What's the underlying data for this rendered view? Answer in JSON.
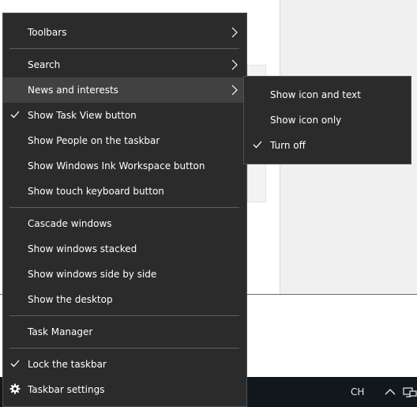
{
  "context_menu": {
    "items": [
      {
        "label": "Toolbars",
        "submenu": true
      },
      {
        "label": "Search",
        "submenu": true
      },
      {
        "label": "News and interests",
        "submenu": true,
        "highlighted": true
      },
      {
        "label": "Show Task View button",
        "checked": true
      },
      {
        "label": "Show People on the taskbar"
      },
      {
        "label": "Show Windows Ink Workspace button"
      },
      {
        "label": "Show touch keyboard button"
      },
      {
        "label": "Cascade windows"
      },
      {
        "label": "Show windows stacked"
      },
      {
        "label": "Show windows side by side"
      },
      {
        "label": "Show the desktop"
      },
      {
        "label": "Task Manager"
      },
      {
        "label": "Lock the taskbar",
        "checked": true
      },
      {
        "label": "Taskbar settings",
        "icon": "gear-icon"
      }
    ]
  },
  "news_submenu": {
    "items": [
      {
        "label": "Show icon and text"
      },
      {
        "label": "Show icon only"
      },
      {
        "label": "Turn off",
        "checked": true
      }
    ]
  },
  "taskbar": {
    "language": "CH",
    "tray_icons": [
      "chevron-up-icon",
      "network-icon"
    ]
  },
  "colors": {
    "menu_bg": "#2b2b2b",
    "menu_hover": "#414141",
    "separator": "#5d5d5d",
    "taskbar_bg": "#11181d",
    "text": "#ffffff"
  }
}
